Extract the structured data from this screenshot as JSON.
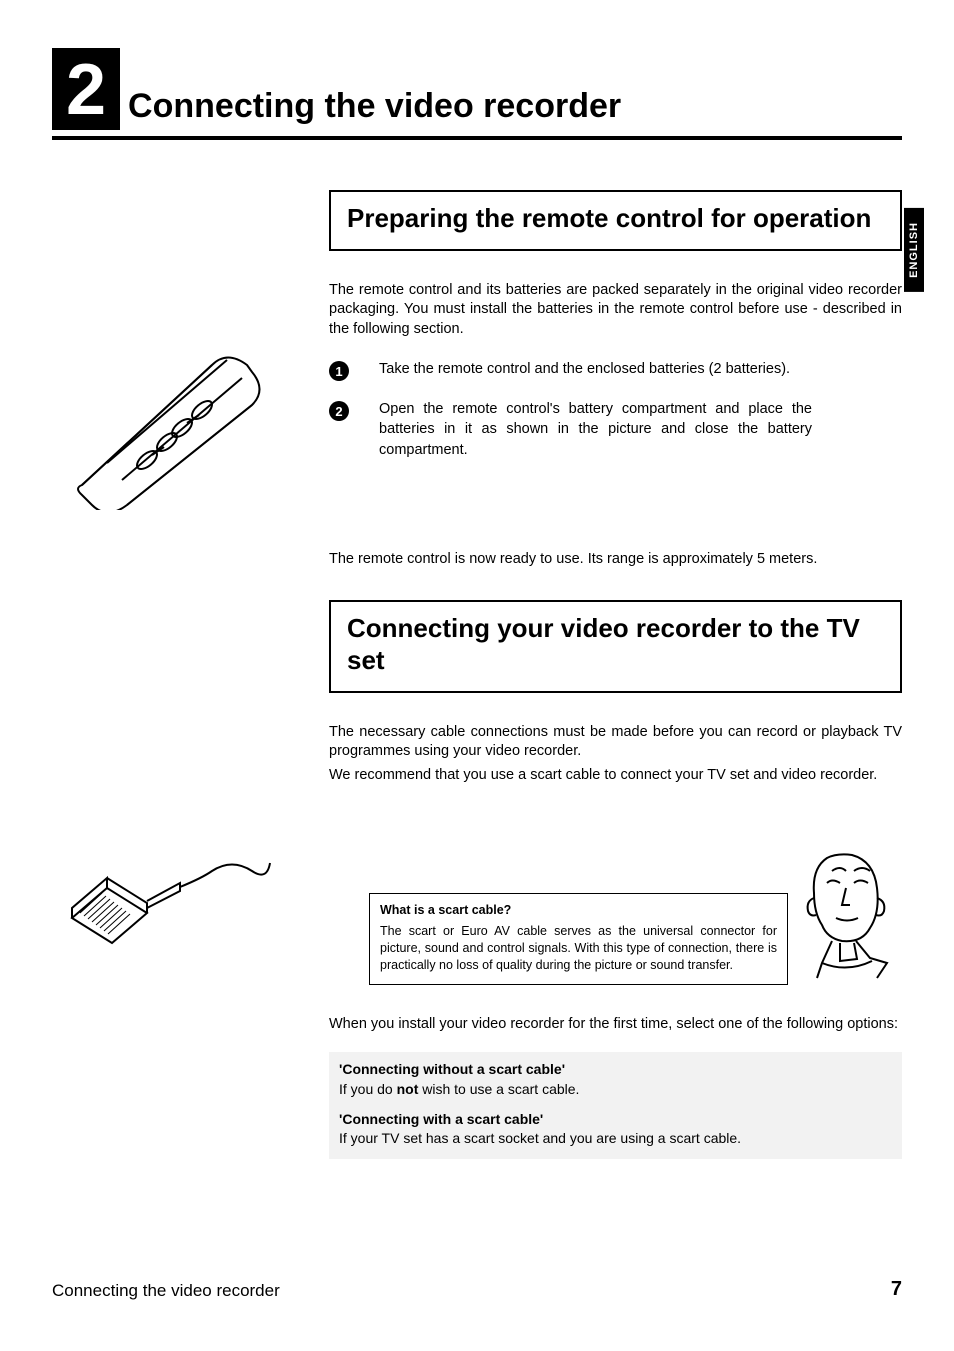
{
  "chapter": {
    "number": "2",
    "title": "Connecting the video recorder"
  },
  "side_tab": "ENGLISH",
  "section1": {
    "heading": "Preparing the remote control for operation",
    "intro": "The remote control and its batteries are packed separately in the original video recorder packaging. You must install the batteries in the remote control before use - described in the following section.",
    "steps": [
      "Take the remote control and the enclosed batteries (2 batteries).",
      "Open the remote control's battery compartment and place the batteries in it as shown in the picture and close the battery compartment."
    ],
    "outro": "The remote control is now ready to use. Its range is approximately 5 meters."
  },
  "section2": {
    "heading": "Connecting your video recorder to the TV set",
    "intro1": "The necessary cable connections must be made before you can record or playback TV programmes using your video recorder.",
    "intro2": "We recommend that you use a scart cable to connect your TV set and video recorder.",
    "callout": {
      "title": "What is a scart cable?",
      "body": "The scart or Euro AV cable serves as the universal connector for picture, sound and control signals. With this type of connection, there is practically no loss of quality during the picture or sound transfer."
    },
    "options_intro": "When you install your video recorder for the first time, select one of the following options:",
    "options": [
      {
        "title": "'Connecting without a scart cable'",
        "body_pre": "If you do ",
        "body_bold": "not",
        "body_post": " wish to use a scart cable."
      },
      {
        "title": "'Connecting with a scart cable'",
        "body_pre": "If your TV set has a scart socket and you are using a scart cable.",
        "body_bold": "",
        "body_post": ""
      }
    ]
  },
  "footer": {
    "label": "Connecting the video recorder",
    "page": "7"
  }
}
